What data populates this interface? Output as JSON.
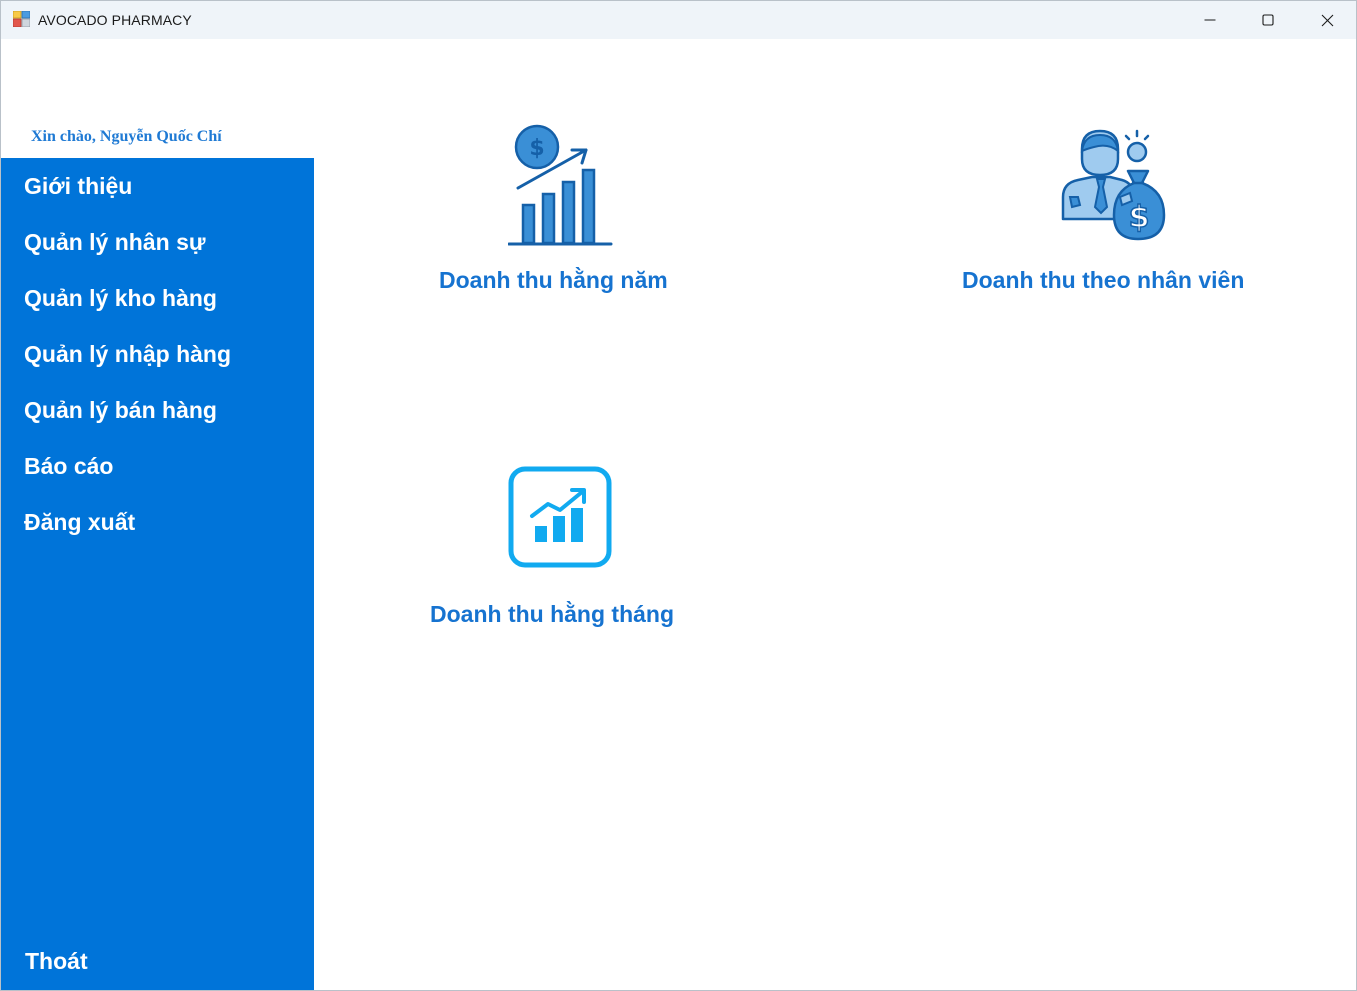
{
  "window": {
    "title": "AVOCADO PHARMACY",
    "controls": [
      "minimize-icon",
      "maximize-icon",
      "close-icon"
    ]
  },
  "greeting": "Xin chào, Nguyễn Quốc Chí",
  "sidebar": {
    "items": [
      {
        "label": "Giới thiệu"
      },
      {
        "label": "Quản lý nhân sự"
      },
      {
        "label": "Quản lý kho hàng"
      },
      {
        "label": "Quản lý nhập hàng"
      },
      {
        "label": "Quản lý bán hàng"
      },
      {
        "label": "Báo cáo"
      },
      {
        "label": "Đăng xuất"
      }
    ],
    "exit_label": "Thoát"
  },
  "reports": [
    {
      "label": "Doanh thu hằng năm",
      "icon": "annual-revenue-chart-icon"
    },
    {
      "label": "Doanh thu theo nhân viên",
      "icon": "employee-revenue-icon"
    },
    {
      "label": "Doanh thu hằng tháng",
      "icon": "monthly-revenue-chart-icon"
    }
  ],
  "colors": {
    "sidebar": "#0074d9",
    "accent_text": "#1673d0",
    "icon_blue": "#3a8fd6",
    "icon_dark": "#1560a8",
    "icon_cyan": "#11aaf0",
    "titlebar": "#eff4f9"
  }
}
